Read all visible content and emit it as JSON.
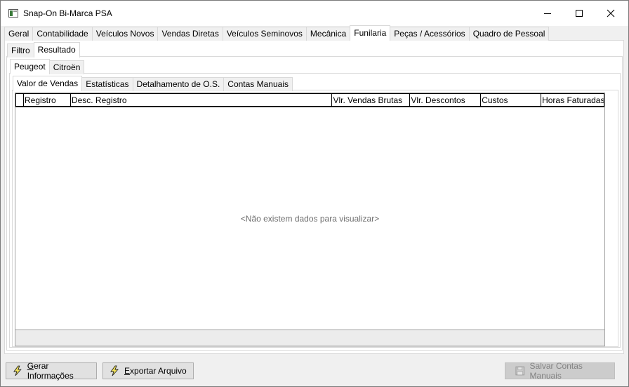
{
  "window": {
    "title": "Snap-On Bi-Marca PSA"
  },
  "main_tabs": [
    {
      "label": "Geral"
    },
    {
      "label": "Contabilidade"
    },
    {
      "label": "Veículos Novos"
    },
    {
      "label": "Vendas Diretas"
    },
    {
      "label": "Veículos Seminovos"
    },
    {
      "label": "Mecânica"
    },
    {
      "label": "Funilaria",
      "active": true
    },
    {
      "label": "Peças / Acessórios"
    },
    {
      "label": "Quadro de Pessoal"
    }
  ],
  "sub_tabs": [
    {
      "label": "Filtro"
    },
    {
      "label": "Resultado",
      "active": true
    }
  ],
  "brand_tabs": [
    {
      "label": "Peugeot",
      "active": true
    },
    {
      "label": "Citroën"
    }
  ],
  "view_tabs": [
    {
      "label": "Valor de Vendas",
      "active": true
    },
    {
      "label": "Estatísticas"
    },
    {
      "label": "Detalhamento de O.S."
    },
    {
      "label": "Contas Manuais"
    }
  ],
  "grid": {
    "columns": [
      "",
      "Registro",
      "Desc. Registro",
      "Vlr. Vendas Brutas",
      "Vlr. Descontos",
      "Custos",
      "Horas Faturadas"
    ],
    "empty_message": "<Não existem dados para visualizar>"
  },
  "buttons": {
    "gerar": {
      "label_accel": "G",
      "label_rest": "erar Informações",
      "icon": "lightning-icon"
    },
    "exportar": {
      "label_accel": "E",
      "label_rest": "xportar Arquivo",
      "icon": "lightning-icon"
    },
    "salvar": {
      "label": "Salvar Contas Manuais",
      "icon": "floppy-disk-icon",
      "disabled": true
    }
  }
}
